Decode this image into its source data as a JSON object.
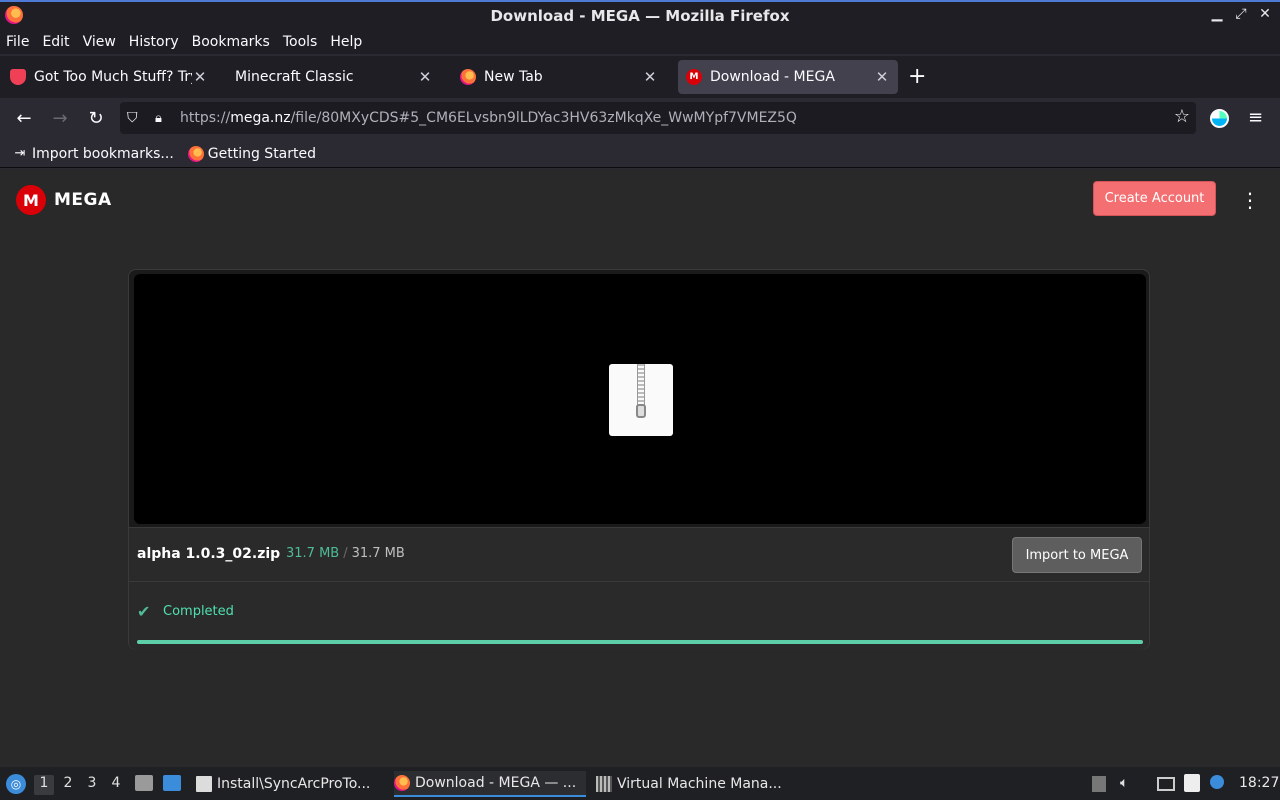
{
  "window": {
    "title": "Download - MEGA — Mozilla Firefox",
    "min": "▁",
    "max": "⤢",
    "close": "✕"
  },
  "menu": [
    "File",
    "Edit",
    "View",
    "History",
    "Bookmarks",
    "Tools",
    "Help"
  ],
  "tabs": [
    {
      "label": "Got Too Much Stuff? Try T",
      "icon": "pocket-icon",
      "close": "✕"
    },
    {
      "label": "Minecraft Classic",
      "icon": "",
      "close": "✕"
    },
    {
      "label": "New Tab",
      "icon": "firefox-icon",
      "close": "✕"
    },
    {
      "label": "Download - MEGA",
      "icon": "mega-icon",
      "close": "✕",
      "active": true
    }
  ],
  "new_tab": "+",
  "nav": {
    "back": "←",
    "forward": "→",
    "reload": "↻",
    "url_prefix": "https://",
    "url_host": "mega.nz",
    "url_path": "/file/80MXyCDS#5_CM6ELvsbn9lLDYac3HV63zMkqXe_WwMYpf7VMEZ5Q",
    "star": "☆",
    "menu": "≡"
  },
  "bookmarks": [
    {
      "label": "Import bookmarks...",
      "icon": "import-icon"
    },
    {
      "label": "Getting Started",
      "icon": "firefox-icon"
    }
  ],
  "mega": {
    "logo_letter": "M",
    "logo_text": "MEGA",
    "create_account": "Create Account",
    "kebab": "⋮",
    "file_name": "alpha 1.0.3_02.zip",
    "downloaded": "31.7 MB",
    "sep": "/",
    "total": "31.7 MB",
    "import_button": "Import to MEGA",
    "status": "Completed",
    "check": "✔",
    "progress_fraction": 1.0
  },
  "taskbar": {
    "start": "◎",
    "workspaces": [
      "1",
      "2",
      "3",
      "4"
    ],
    "active_workspace": "1",
    "tasks": [
      {
        "label": "Install\\SyncArcProTo...",
        "icon": "document-icon"
      },
      {
        "label": "Download - MEGA — ...",
        "icon": "firefox-icon",
        "active": true
      },
      {
        "label": "Virtual Machine Mana...",
        "icon": "vm-manager-icon"
      }
    ],
    "clock": "18:27"
  },
  "colors": {
    "accent": "#4fbc95",
    "create_button": "#f46f72",
    "mega_red": "#d90007"
  }
}
